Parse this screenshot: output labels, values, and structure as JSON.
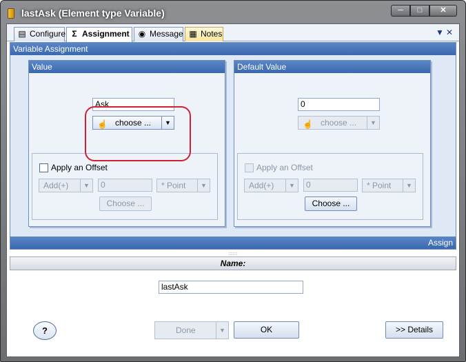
{
  "window": {
    "title": "lastAsk (Element type Variable)",
    "controls": [
      "─",
      "□",
      "✕"
    ]
  },
  "tabs": [
    {
      "label": "Configure",
      "icon": "configure-icon"
    },
    {
      "label": "Assignment",
      "icon": "sigma-icon"
    },
    {
      "label": "Message",
      "icon": "message-icon"
    },
    {
      "label": "Notes",
      "icon": "notes-icon"
    }
  ],
  "tab_controls": {
    "pin": "▼",
    "close": "✕"
  },
  "assignment": {
    "title": "Variable Assignment",
    "footer_label": "Assign",
    "value_panel": {
      "title": "Value",
      "value_input": "Ask",
      "choose_combo": "choose ...",
      "offset_label": "Apply an Offset",
      "op_combo": "Add(+)",
      "offset_input": "0",
      "unit_combo": "* Point",
      "choose_button": "Choose ..."
    },
    "default_panel": {
      "title": "Default Value",
      "value_input": "0",
      "choose_combo": "choose ...",
      "offset_label": "Apply an Offset",
      "op_combo": "Add(+)",
      "offset_input": "0",
      "unit_combo": "* Point",
      "choose_button": "Choose ..."
    }
  },
  "splitter_grip": "::::::::",
  "name_section": {
    "label": "Name:",
    "value": "lastAsk"
  },
  "footer": {
    "help": "?",
    "done": "Done",
    "ok": "OK",
    "details": ">> Details"
  }
}
